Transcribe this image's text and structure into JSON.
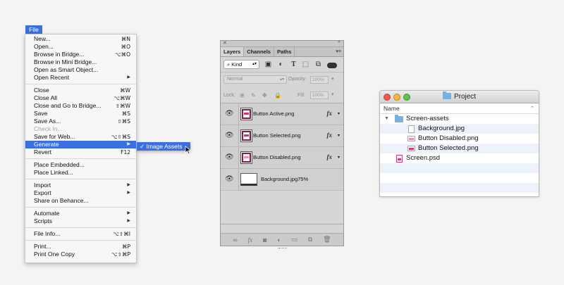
{
  "menu": {
    "title": "File",
    "items": [
      {
        "label": "New...",
        "shortcut": "⌘N"
      },
      {
        "label": "Open...",
        "shortcut": "⌘O"
      },
      {
        "label": "Browse in Bridge...",
        "shortcut": "⌥⌘O"
      },
      {
        "label": "Browse in Mini Bridge..."
      },
      {
        "label": "Open as Smart Object..."
      },
      {
        "label": "Open Recent",
        "submenu": true
      },
      {
        "label": "Close",
        "shortcut": "⌘W"
      },
      {
        "label": "Close All",
        "shortcut": "⌥⌘W"
      },
      {
        "label": "Close and Go to Bridge...",
        "shortcut": "⇧⌘W"
      },
      {
        "label": "Save",
        "shortcut": "⌘S"
      },
      {
        "label": "Save As...",
        "shortcut": "⇧⌘S"
      },
      {
        "label": "Check In..."
      },
      {
        "label": "Save for Web...",
        "shortcut": "⌥⇧⌘S"
      },
      {
        "label": "Generate",
        "submenu": true
      },
      {
        "label": "Revert",
        "shortcut": "F12"
      },
      {
        "label": "Place Embedded..."
      },
      {
        "label": "Place Linked..."
      },
      {
        "label": "Import",
        "submenu": true
      },
      {
        "label": "Export",
        "submenu": true
      },
      {
        "label": "Share on Behance..."
      },
      {
        "label": "Automate",
        "submenu": true
      },
      {
        "label": "Scripts",
        "submenu": true
      },
      {
        "label": "File Info...",
        "shortcut": "⌥⇧⌘I"
      },
      {
        "label": "Print...",
        "shortcut": "⌘P"
      },
      {
        "label": "Print One Copy",
        "shortcut": "⌥⇧⌘P"
      }
    ],
    "submenu_item": "✓ Image Assets"
  },
  "layers_panel": {
    "tabs": [
      "Layers",
      "Channels",
      "Paths"
    ],
    "kind_label": "Kind",
    "blend_mode": "Normal",
    "opacity_label": "Opacity:",
    "opacity_value": "100%",
    "lock_label": "Lock:",
    "fill_label": "Fill:",
    "fill_value": "100%",
    "layers": [
      {
        "name": "Button Active.png",
        "fx": "fx"
      },
      {
        "name": "Button Selected.png",
        "fx": "fx"
      },
      {
        "name": "Button Disabled.png",
        "fx": "fx"
      },
      {
        "name": "Background.jpg75%"
      }
    ]
  },
  "finder": {
    "title": "Project",
    "column": "Name",
    "rows": [
      {
        "name": "Screen-assets"
      },
      {
        "name": "Background.jpg"
      },
      {
        "name": "Button Disabled.png"
      },
      {
        "name": "Button Selected.png"
      },
      {
        "name": "Screen.psd"
      }
    ]
  },
  "colors": {
    "menu_highlight": "#3b6fe0",
    "png_disabled": "#e690b6",
    "png_selected": "#d23b7a"
  }
}
